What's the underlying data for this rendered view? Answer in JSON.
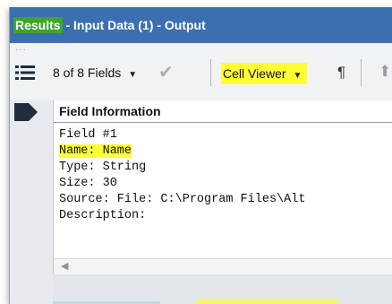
{
  "window": {
    "title_highlight": "Results",
    "title_rest": " - Input Data (1) - Output"
  },
  "toolbar": {
    "fields_selector": "8 of 8 Fields",
    "viewer_selector": "Cell Viewer",
    "pilcrow": "¶",
    "up_arrow": "⬆"
  },
  "panel": {
    "header": "Field Information",
    "lines": [
      "Field #1",
      "Name: Name",
      "Type: String",
      "Size: 30",
      "Source: File: C:\\Program Files\\Alt",
      "Description:"
    ]
  },
  "colors": {
    "titlebar": "#3c6fb0",
    "title_highlight": "#3fa32e",
    "highlight": "#ffff33"
  },
  "icons": [
    "grip-dots-icon",
    "list-view-icon",
    "chevron-down-icon",
    "checkmark-icon",
    "pilcrow-icon",
    "up-arrow-icon",
    "tag-icon",
    "scroll-left-icon"
  ]
}
